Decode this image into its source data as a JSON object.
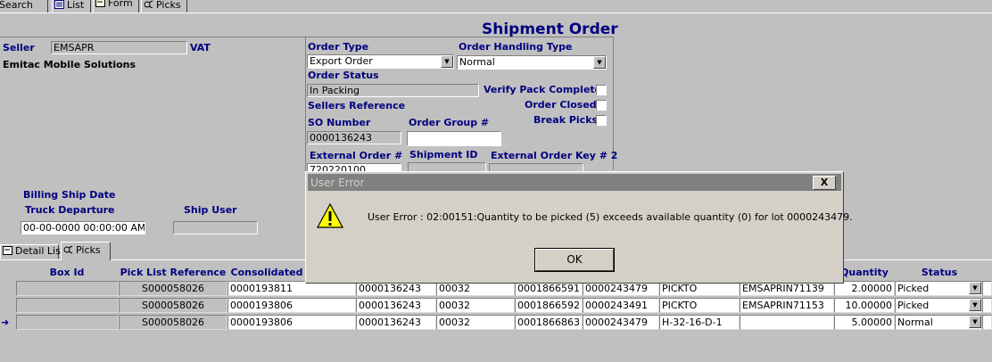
{
  "toolbar_tabs": [
    {
      "label": "Search",
      "icon": "search-icon"
    },
    {
      "label": "List",
      "icon": "list-icon"
    },
    {
      "label": "Form",
      "icon": "form-icon"
    },
    {
      "label": "Picks",
      "icon": "picks-icon"
    }
  ],
  "page_title": "Shipment Order",
  "seller": {
    "label": "Seller",
    "value": "EMSAPR",
    "vat_label": "VAT",
    "name": "Emitac Mobile Solutions"
  },
  "order": {
    "type_label": "Order Type",
    "type_value": "Export Order",
    "handling_label": "Order Handling Type",
    "handling_value": "Normal",
    "status_label": "Order Status",
    "status_value": "In Packing",
    "verify_pack_label": "Verify Pack Complete",
    "sellers_ref_label": "Sellers Reference",
    "order_closed_label": "Order Closed",
    "break_picks_label": "Break Picks",
    "so_number_label": "SO Number",
    "so_number_value": "0000136243",
    "order_group_label": "Order Group #",
    "order_group_value": "",
    "external_order_label": "External Order #",
    "external_order_value": "720220100",
    "shipment_id_label": "Shipment ID",
    "external_key2_label": "External Order Key # 2"
  },
  "shipping": {
    "billing_ship_date_label": "Billing Ship Date",
    "truck_departure_label": "Truck Departure",
    "truck_departure_value": "00-00-0000 00:00:00 AM",
    "ship_user_label": "Ship User",
    "ship_user_value": ""
  },
  "detail_tabs": [
    {
      "label": "Detail List",
      "icon": "detail-list-icon"
    },
    {
      "label": "Picks",
      "icon": "picks-icon"
    }
  ],
  "grid": {
    "headers": [
      "Box Id",
      "Pick List Reference",
      "Consolidated",
      "Quantity",
      "Status"
    ],
    "rows": [
      {
        "box_id": "",
        "pick_list_ref": "S000058026",
        "consolidated": "0000193811",
        "so": "0000136243",
        "line": "00032",
        "pick_id": "0001866591",
        "lot": "0000243479",
        "location": "PICKTO",
        "container": "EMSAPRIN71139",
        "quantity": "2.00000",
        "status": "Picked",
        "current": false
      },
      {
        "box_id": "",
        "pick_list_ref": "S000058026",
        "consolidated": "0000193806",
        "so": "0000136243",
        "line": "00032",
        "pick_id": "0001866592",
        "lot": "0000243491",
        "location": "PICKTO",
        "container": "EMSAPRIN71153",
        "quantity": "10.00000",
        "status": "Picked",
        "current": false
      },
      {
        "box_id": "",
        "pick_list_ref": "S000058026",
        "consolidated": "0000193806",
        "so": "0000136243",
        "line": "00032",
        "pick_id": "0001866863",
        "lot": "0000243479",
        "location": "H-32-16-D-1",
        "container": "",
        "quantity": "5.00000",
        "status": "Normal",
        "current": true
      }
    ]
  },
  "dialog": {
    "title": "User Error",
    "close_label": "X",
    "message": "User Error : 02:00151:Quantity to be picked (5) exceeds available quantity (0) for lot 0000243479.",
    "ok_label": "OK",
    "icon": "warning-icon"
  },
  "colors": {
    "window_bg": "#c0c0c0",
    "label_navy": "#000080",
    "dialog_bg": "#d4d0c8",
    "dialog_title_bg": "#808080"
  }
}
